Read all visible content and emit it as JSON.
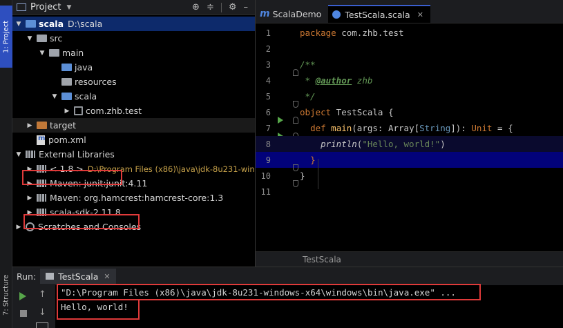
{
  "strip": {
    "project_tab": "1: Project",
    "structure_tab": "7: Structure"
  },
  "project": {
    "title": "Project",
    "tree": {
      "root_name": "scala",
      "root_path": "D:\\scala",
      "src": "src",
      "main": "main",
      "java": "java",
      "resources": "resources",
      "scala": "scala",
      "pkg": "com.zhb.test",
      "target": "target",
      "pom": "pom.xml",
      "ext_libs": "External Libraries",
      "jdk_label": "< 1.8 >",
      "jdk_path": "D:\\Program Files (x86)\\java\\jdk-8u231-win",
      "maven_junit": "Maven: junit:junit:4.11",
      "maven_hamcrest": "Maven: org.hamcrest:hamcrest-core:1.3",
      "scala_sdk": "scala-sdk-2.11.8",
      "scratches": "Scratches and Consoles"
    }
  },
  "editor": {
    "tabs": [
      {
        "label": "ScalaDemo"
      },
      {
        "label": "TestScala.scala"
      }
    ],
    "lines": {
      "l1": [
        "package",
        " com.zhb.test"
      ],
      "l3": "/**",
      "l4a": " * ",
      "l4b": "@author",
      "l4c": " zhb",
      "l5": " */",
      "l6a": "object",
      "l6b": " TestScala {",
      "l7a": "def",
      "l7b": " main",
      "l7c": "(args: Array[",
      "l7d": "String",
      "l7e": "]): ",
      "l7f": "Unit",
      "l7g": " = {",
      "l8a": "println",
      "l8b": "(",
      "l8c": "\"Hello, world!\"",
      "l8d": ")",
      "l9": "}",
      "l10": "}"
    },
    "line_numbers": [
      "1",
      "2",
      "3",
      "4",
      "5",
      "6",
      "7",
      "8",
      "9",
      "10",
      "11"
    ],
    "footer": "TestScala"
  },
  "run": {
    "label": "Run:",
    "tab": "TestScala",
    "console": [
      "\"D:\\Program Files (x86)\\java\\jdk-8u231-windows-x64\\windows\\bin\\java.exe\" ...",
      "Hello, world!"
    ]
  }
}
